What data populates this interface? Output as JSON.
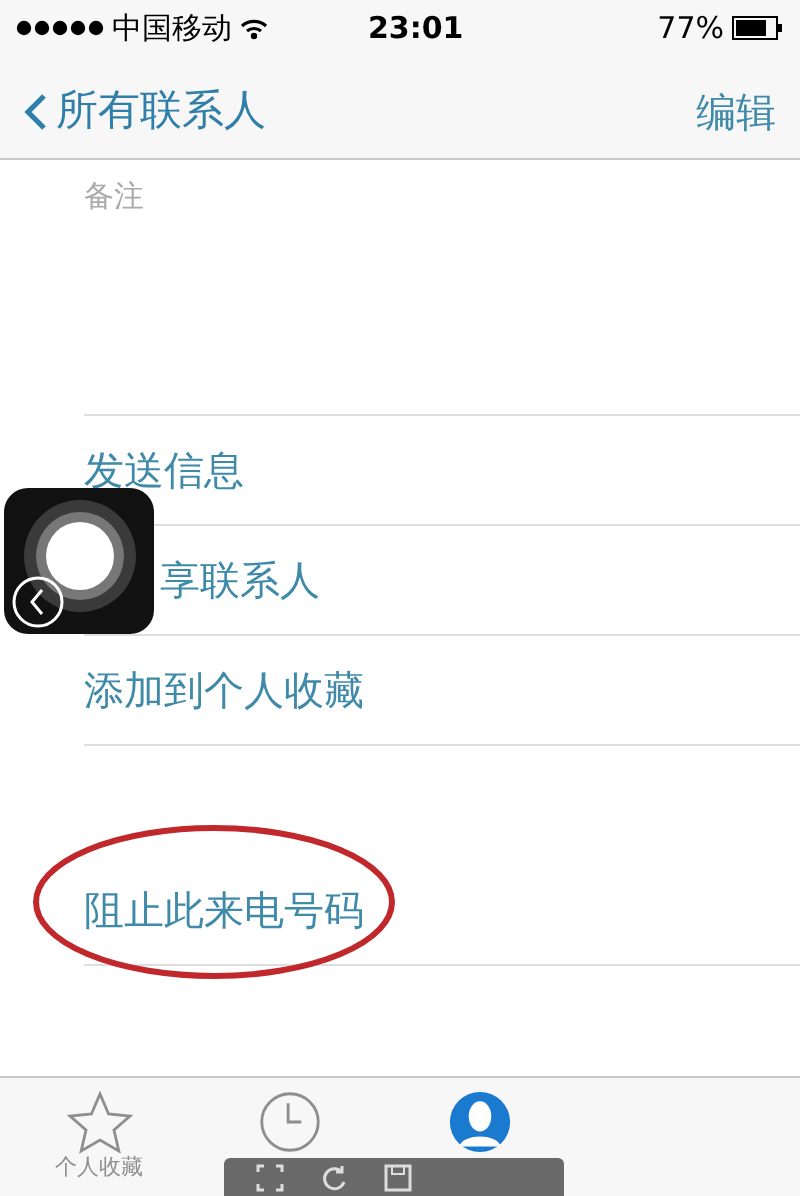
{
  "status_bar": {
    "carrier": "中国移动",
    "time": "23:01",
    "battery": "77%"
  },
  "nav_bar": {
    "back": "所有联系人",
    "action": "编辑"
  },
  "notes_label": "备注",
  "actions": [
    {
      "label": "发送信息",
      "kind": "plain"
    },
    {
      "label": "享联系人",
      "kind": "covered"
    },
    {
      "label": "添加到个人收藏",
      "kind": "plain"
    }
  ],
  "block_action": {
    "label": "阻止此来电号码",
    "circled": true
  },
  "tab_bar": [
    {
      "label": "个人收藏",
      "kind": "star",
      "selected": false
    },
    {
      "kind": "clock",
      "selected": false
    },
    {
      "kind": "person",
      "selected": true
    }
  ]
}
